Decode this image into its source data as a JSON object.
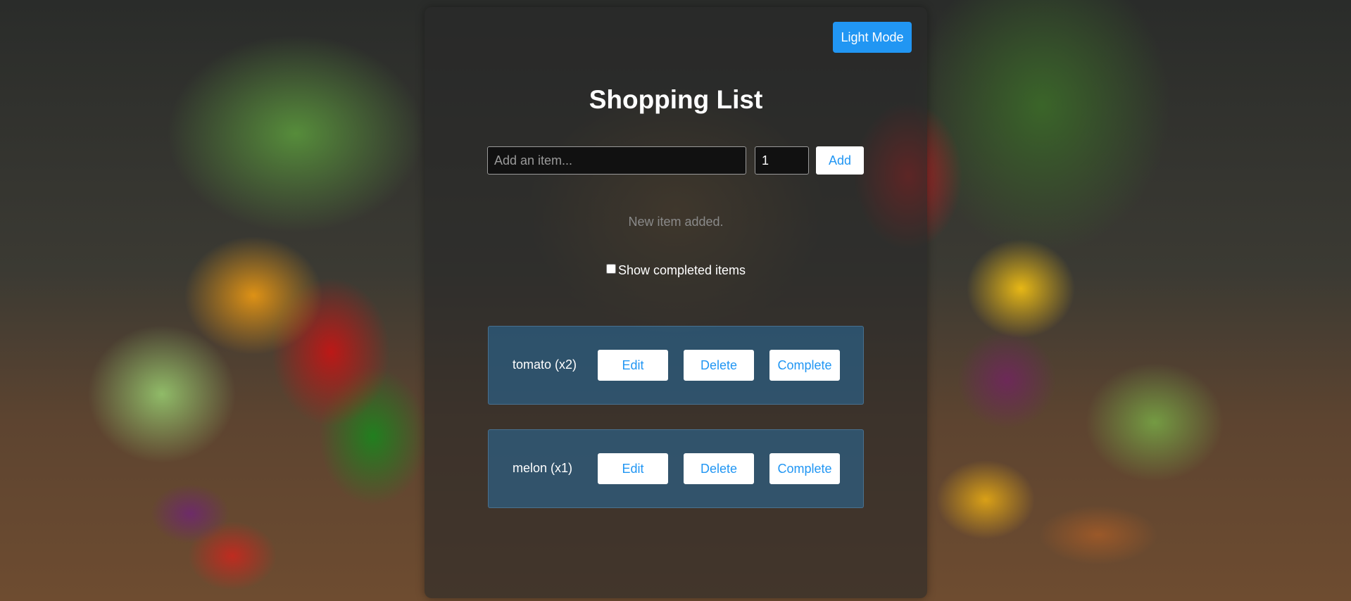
{
  "header": {
    "theme_toggle_label": "Light Mode",
    "title": "Shopping List"
  },
  "form": {
    "item_placeholder": "Add an item...",
    "item_value": "",
    "quantity_value": "1",
    "add_label": "Add"
  },
  "status_message": "New item added.",
  "filter": {
    "show_completed_label": "Show completed items",
    "show_completed_checked": false
  },
  "items": [
    {
      "label": "tomato (x2)",
      "edit_label": "Edit",
      "delete_label": "Delete",
      "complete_label": "Complete"
    },
    {
      "label": "melon (x1)",
      "edit_label": "Edit",
      "delete_label": "Delete",
      "complete_label": "Complete"
    }
  ],
  "colors": {
    "accent": "#2196f3",
    "item_background": "#286ea0",
    "card_background": "#282828"
  }
}
